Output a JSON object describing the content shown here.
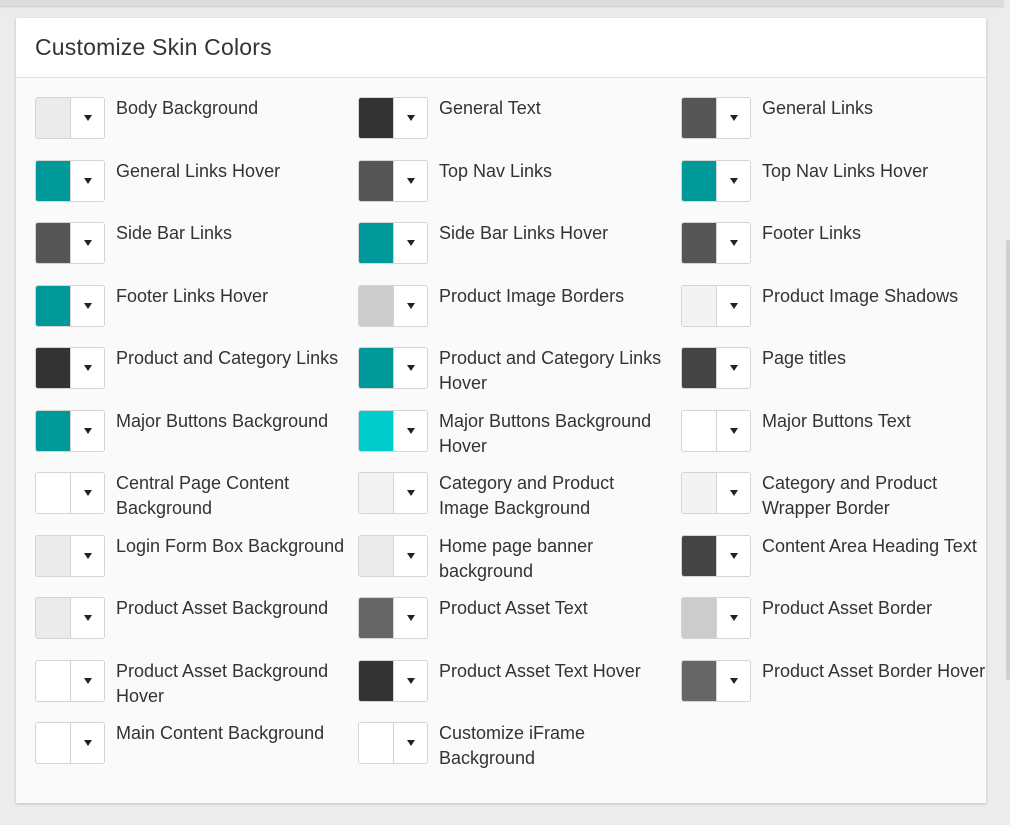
{
  "panel": {
    "title": "Customize Skin Colors"
  },
  "items": [
    {
      "label": "Body Background",
      "color": "#ebebeb"
    },
    {
      "label": "General Text",
      "color": "#333333"
    },
    {
      "label": "General Links",
      "color": "#555555"
    },
    {
      "label": "General Links Hover",
      "color": "#009999"
    },
    {
      "label": "Top Nav Links",
      "color": "#555555"
    },
    {
      "label": "Top Nav Links Hover",
      "color": "#009999"
    },
    {
      "label": "Side Bar Links",
      "color": "#555555"
    },
    {
      "label": "Side Bar Links Hover",
      "color": "#009999"
    },
    {
      "label": "Footer Links",
      "color": "#555555"
    },
    {
      "label": "Footer Links Hover",
      "color": "#009999"
    },
    {
      "label": "Product Image Borders",
      "color": "#cccccc"
    },
    {
      "label": "Product Image Shadows",
      "color": "#f3f3f3"
    },
    {
      "label": "Product and Category Links",
      "color": "#333333"
    },
    {
      "label": "Product and Category Links Hover",
      "color": "#009999"
    },
    {
      "label": "Page titles",
      "color": "#444444"
    },
    {
      "label": "Major Buttons Background",
      "color": "#009999"
    },
    {
      "label": "Major Buttons Background Hover",
      "color": "#00cccc"
    },
    {
      "label": "Major Buttons Text",
      "color": "#ffffff"
    },
    {
      "label": "Central Page Content Background",
      "color": "#ffffff"
    },
    {
      "label": "Category and Product Image Background",
      "color": "#f3f3f3"
    },
    {
      "label": "Category and Product Wrapper Border",
      "color": "#f3f3f3"
    },
    {
      "label": "Login Form Box Background",
      "color": "#ebebeb"
    },
    {
      "label": "Home page banner background",
      "color": "#ebebeb"
    },
    {
      "label": "Content Area Heading Text",
      "color": "#444444"
    },
    {
      "label": "Product Asset Background",
      "color": "#ebebeb"
    },
    {
      "label": "Product Asset Text",
      "color": "#666666"
    },
    {
      "label": "Product Asset Border",
      "color": "#cccccc"
    },
    {
      "label": "Product Asset Background Hover",
      "color": "#ffffff"
    },
    {
      "label": "Product Asset Text Hover",
      "color": "#333333"
    },
    {
      "label": "Product Asset Border Hover",
      "color": "#666666"
    },
    {
      "label": "Main Content Background",
      "color": "#ffffff"
    },
    {
      "label": "Customize iFrame Background",
      "color": "#ffffff"
    }
  ]
}
